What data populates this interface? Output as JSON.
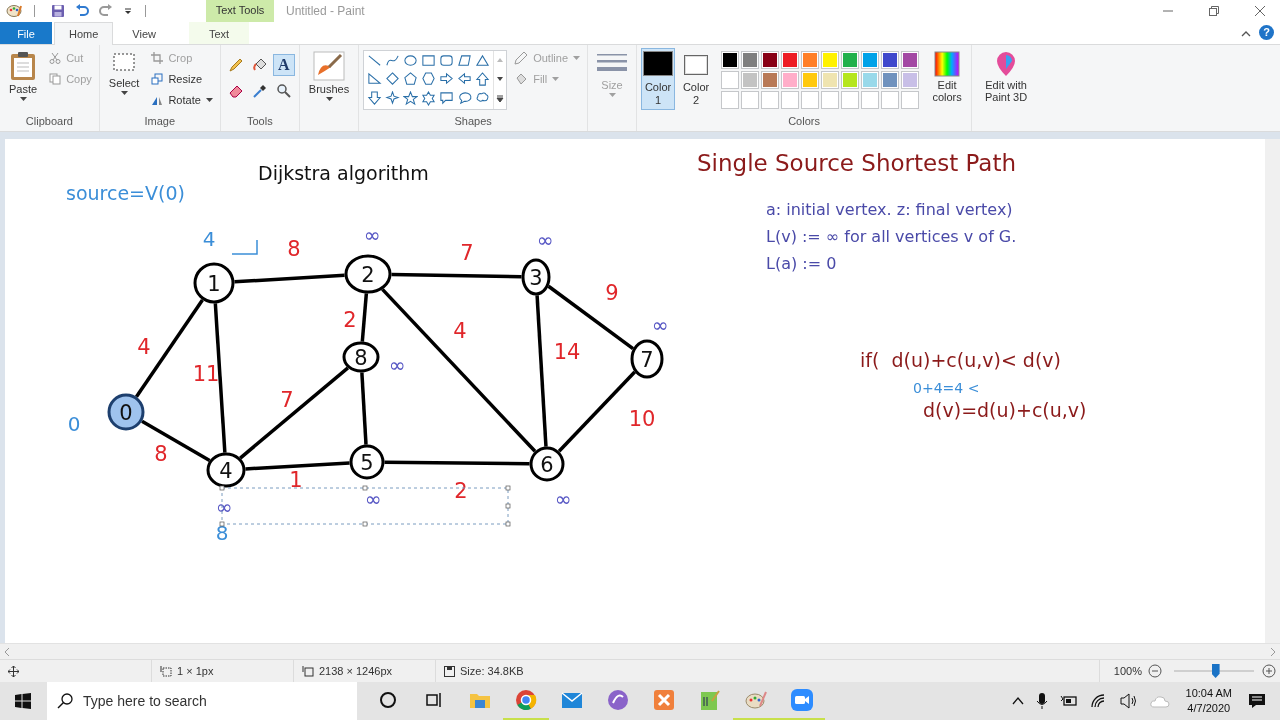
{
  "title_bar": {
    "context_tab": "Text Tools",
    "title": "Untitled - Paint",
    "help": "?"
  },
  "tabs": [
    {
      "label": "File",
      "kind": "file",
      "selected": false
    },
    {
      "label": "Home",
      "kind": "tab",
      "selected": true
    },
    {
      "label": "View",
      "kind": "tab",
      "selected": false
    },
    {
      "label": "Text",
      "kind": "context",
      "selected": false
    }
  ],
  "clipboard": {
    "paste": "Paste",
    "cut": {
      "label": "Cut",
      "disabled": true
    },
    "copy": {
      "label": "Copy",
      "disabled": true
    },
    "group": "Clipboard"
  },
  "image": {
    "select": "Select",
    "crop": {
      "label": "Crop",
      "disabled": true
    },
    "resize": "Resize",
    "rotate": "Rotate",
    "group": "Image"
  },
  "tools": {
    "group": "Tools",
    "items": [
      {
        "kind": "pencil",
        "selected": false
      },
      {
        "kind": "fill",
        "selected": false
      },
      {
        "kind": "text",
        "glyph": "A",
        "selected": true
      },
      {
        "kind": "eraser",
        "selected": false
      },
      {
        "kind": "picker",
        "selected": false
      },
      {
        "kind": "magnifier",
        "selected": false
      }
    ]
  },
  "brushes": "Brushes",
  "shapes": {
    "outline": {
      "label": "Outline",
      "disabled": true
    },
    "fill": {
      "label": "Fill",
      "disabled": true
    },
    "group": "Shapes"
  },
  "size": {
    "label": "Size",
    "disabled": true
  },
  "colors": {
    "color1": {
      "label": "Color 1",
      "color": "#000000",
      "selected": true
    },
    "color2": {
      "label": "Color 2",
      "color": "#ffffff",
      "selected": false
    },
    "palette": [
      {
        "color": "#000000"
      },
      {
        "color": "#7f7f7f"
      },
      {
        "color": "#880015"
      },
      {
        "color": "#ed1c24"
      },
      {
        "color": "#ff7f27"
      },
      {
        "color": "#fff200"
      },
      {
        "color": "#22b14c"
      },
      {
        "color": "#00a2e8"
      },
      {
        "color": "#3f48cc"
      },
      {
        "color": "#a349a4"
      },
      {
        "color": "#ffffff"
      },
      {
        "color": "#c3c3c3"
      },
      {
        "color": "#b97a57"
      },
      {
        "color": "#ffaec9"
      },
      {
        "color": "#ffc90e"
      },
      {
        "color": "#efe4b0"
      },
      {
        "color": "#b5e61d"
      },
      {
        "color": "#99d9ea"
      },
      {
        "color": "#7092be"
      },
      {
        "color": "#c8bfe7"
      }
    ],
    "edit": "Edit colors",
    "group": "Colors"
  },
  "paint3d": "Edit with Paint 3D",
  "canvas": {
    "title": "Dijkstra algorithm",
    "source": "source=V(0)",
    "heading": "Single Source Shortest Path",
    "notes": [
      "a: initial vertex. z: final vertex)",
      "L(v) := ∞ for all vertices v of G.",
      "L(a) := 0"
    ],
    "condition": "if(  d(u)+c(u,v)< d(v)",
    "scribble": "0+4=4 <",
    "update": "d(v)=d(u)+c(u,v)",
    "nodes": [
      {
        "label": "0",
        "selected": true
      },
      {
        "label": "1",
        "selected": false
      },
      {
        "label": "2",
        "selected": false
      },
      {
        "label": "3",
        "selected": false
      },
      {
        "label": "4",
        "selected": false
      },
      {
        "label": "5",
        "selected": false
      },
      {
        "label": "6",
        "selected": false
      },
      {
        "label": "7",
        "selected": false
      },
      {
        "label": "8",
        "selected": false
      }
    ],
    "weights": [
      "4",
      "8",
      "8",
      "11",
      "7",
      "2",
      "4",
      "14",
      "9",
      "7",
      "1",
      "2",
      "10"
    ],
    "distances": [
      {
        "text": "4",
        "color": "#3b8ed8"
      },
      {
        "text": "∞",
        "color": "#5656c4"
      },
      {
        "text": "∞",
        "color": "#5656c4"
      },
      {
        "text": "∞",
        "color": "#5656c4"
      },
      {
        "text": "∞",
        "color": "#5656c4"
      },
      {
        "text": "0",
        "color": "#3b8ed8"
      },
      {
        "text": "∞",
        "color": "#5656c4"
      },
      {
        "text": "∞",
        "color": "#5656c4"
      },
      {
        "text": "∞",
        "color": "#5656c4"
      },
      {
        "text": "8",
        "color": "#3b8ed8"
      }
    ]
  },
  "status_bar": {
    "selection": "1 × 1px",
    "canvas_size": "2138 × 1246px",
    "file_size": "Size: 34.8KB",
    "zoom": "100%",
    "zoom_slider": {
      "level": 0.52
    }
  },
  "taskbar": {
    "search_placeholder": "Type here to search",
    "apps": [
      {
        "kind": "cortana",
        "running": false
      },
      {
        "kind": "taskview",
        "running": false
      },
      {
        "kind": "folder",
        "running": false
      },
      {
        "kind": "browser",
        "running": true
      },
      {
        "kind": "mail",
        "running": false
      },
      {
        "kind": "torrent",
        "running": false
      },
      {
        "kind": "xampp",
        "running": false
      },
      {
        "kind": "notepad",
        "running": false
      },
      {
        "kind": "paint",
        "running": true
      },
      {
        "kind": "video",
        "running": true
      }
    ],
    "time": "10:04 AM",
    "date": "4/7/2020"
  }
}
